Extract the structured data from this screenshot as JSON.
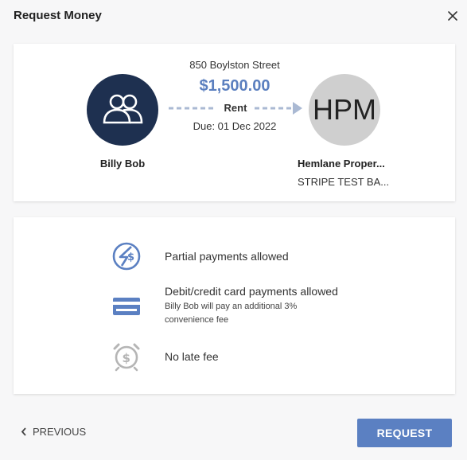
{
  "header": {
    "title": "Request Money"
  },
  "summary": {
    "address": "850 Boylston Street",
    "amount": "$1,500.00",
    "category": "Rent",
    "due": "Due: 01 Dec 2022",
    "payer": {
      "name": "Billy Bob",
      "icon": "users-icon",
      "avatar_color": "#1e3050"
    },
    "payee": {
      "initials": "HPM",
      "name": "Hemlane Proper...",
      "account": "STRIPE TEST BA...",
      "avatar_color": "#cfcfcf"
    }
  },
  "features": [
    {
      "icon": "partial-payment-icon",
      "text": "Partial payments allowed"
    },
    {
      "icon": "credit-card-icon",
      "text": "Debit/credit card payments allowed",
      "subtext": "Billy Bob will pay an additional 3% convenience fee"
    },
    {
      "icon": "alarm-clock-dollar-icon",
      "text": "No late fee"
    }
  ],
  "footer": {
    "previous_label": "PREVIOUS",
    "request_label": "REQUEST"
  },
  "colors": {
    "accent": "#5b80c2",
    "navy": "#1e3050",
    "muted_icon": "#b5b5b5"
  }
}
